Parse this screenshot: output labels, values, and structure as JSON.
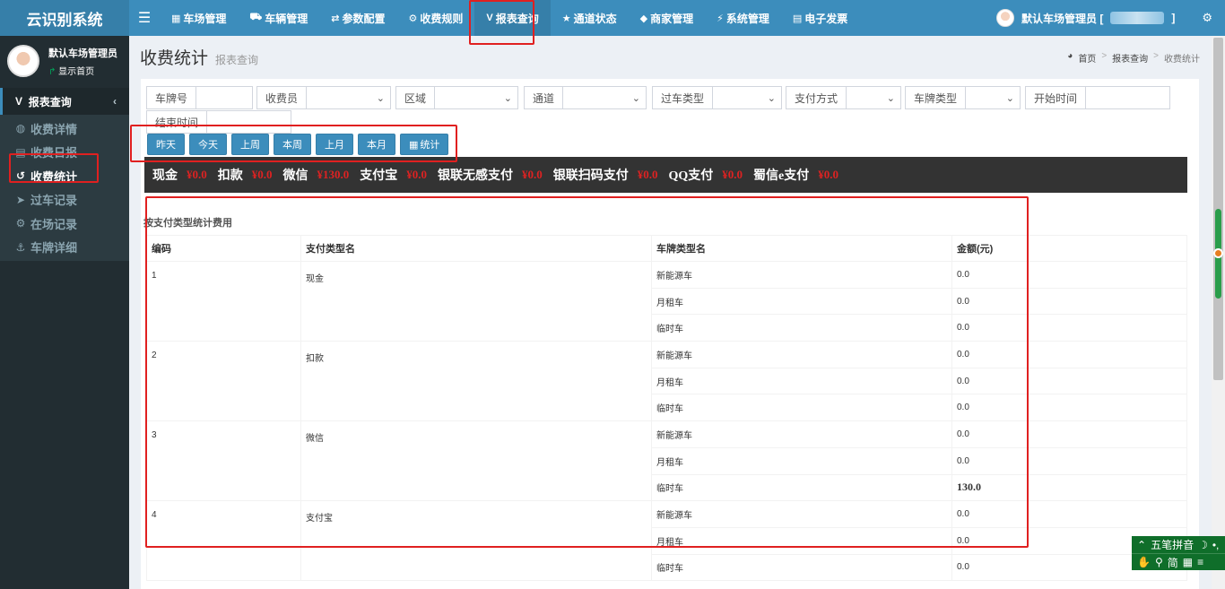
{
  "app": {
    "brand": "云识别系统"
  },
  "topnav": {
    "items": [
      {
        "icon": "▦",
        "label": "车场管理"
      },
      {
        "icon": "⛟",
        "label": "车辆管理"
      },
      {
        "icon": "⇄",
        "label": "参数配置"
      },
      {
        "icon": "⚙",
        "label": "收费规则"
      },
      {
        "icon": "V",
        "label": "报表查询"
      },
      {
        "icon": "★",
        "label": "通道状态"
      },
      {
        "icon": "◆",
        "label": "商家管理"
      },
      {
        "icon": "⚡",
        "label": "系统管理"
      },
      {
        "icon": "▤",
        "label": "电子发票"
      }
    ],
    "user_label": "默认车场管理员 [",
    "user_bracket_close": "]"
  },
  "sidebar": {
    "user_name": "默认车场管理员",
    "user_link": "显示首页",
    "section": {
      "icon": "V",
      "label": "报表查询"
    },
    "items": [
      {
        "icon": "◍",
        "label": "收费详情"
      },
      {
        "icon": "▤",
        "label": "收费日报"
      },
      {
        "icon": "↺",
        "label": "收费统计"
      },
      {
        "icon": "➤",
        "label": "过车记录"
      },
      {
        "icon": "⚙",
        "label": "在场记录"
      },
      {
        "icon": "⚓",
        "label": "车牌详细"
      }
    ]
  },
  "page": {
    "title": "收费统计",
    "subtitle": "报表查询",
    "breadcrumb": [
      "首页",
      "报表查询",
      "收费统计"
    ]
  },
  "filters": [
    {
      "label": "车牌号",
      "type": "text",
      "value": ""
    },
    {
      "label": "收费员",
      "type": "select",
      "value": ""
    },
    {
      "label": "区域",
      "type": "select",
      "value": ""
    },
    {
      "label": "通道",
      "type": "select",
      "value": ""
    },
    {
      "label": "过车类型",
      "type": "select",
      "value": ""
    },
    {
      "label": "支付方式",
      "type": "select",
      "value": ""
    },
    {
      "label": "车牌类型",
      "type": "select",
      "value": ""
    },
    {
      "label": "开始时间",
      "type": "text",
      "value": ""
    },
    {
      "label": "结束时间",
      "type": "text",
      "value": ""
    }
  ],
  "quick_buttons": [
    "昨天",
    "今天",
    "上周",
    "本周",
    "上月",
    "本月"
  ],
  "stats_button": {
    "icon": "▦",
    "label": "统计"
  },
  "summary": [
    {
      "label": "现金",
      "value": "¥0.0"
    },
    {
      "label": "扣款",
      "value": "¥0.0"
    },
    {
      "label": "微信",
      "value": "¥130.0"
    },
    {
      "label": "支付宝",
      "value": "¥0.0"
    },
    {
      "label": "银联无感支付",
      "value": "¥0.0"
    },
    {
      "label": "银联扫码支付",
      "value": "¥0.0"
    },
    {
      "label": "QQ支付",
      "value": "¥0.0"
    },
    {
      "label": "蜀信e支付",
      "value": "¥0.0"
    }
  ],
  "table": {
    "title": "按支付类型统计费用",
    "headers": [
      "编码",
      "支付类型名",
      "车牌类型名",
      "金额(元)"
    ],
    "groups": [
      {
        "code": "1",
        "pay_type": "现金",
        "rows": [
          {
            "plate_type": "新能源车",
            "amount": "0.0"
          },
          {
            "plate_type": "月租车",
            "amount": "0.0"
          },
          {
            "plate_type": "临时车",
            "amount": "0.0"
          }
        ]
      },
      {
        "code": "2",
        "pay_type": "扣款",
        "rows": [
          {
            "plate_type": "新能源车",
            "amount": "0.0"
          },
          {
            "plate_type": "月租车",
            "amount": "0.0"
          },
          {
            "plate_type": "临时车",
            "amount": "0.0"
          }
        ]
      },
      {
        "code": "3",
        "pay_type": "微信",
        "rows": [
          {
            "plate_type": "新能源车",
            "amount": "0.0"
          },
          {
            "plate_type": "月租车",
            "amount": "0.0"
          },
          {
            "plate_type": "临时车",
            "amount": "130.0"
          }
        ]
      },
      {
        "code": "4",
        "pay_type": "支付宝",
        "rows": [
          {
            "plate_type": "新能源车",
            "amount": "0.0"
          },
          {
            "plate_type": "月租车",
            "amount": "0.0"
          },
          {
            "plate_type": "临时车",
            "amount": "0.0"
          }
        ]
      }
    ]
  },
  "ime": {
    "row1": "五笔拼音",
    "row2": "简"
  },
  "colors": {
    "topbar": "#3c8dbc",
    "sidebar": "#222d32",
    "highlight_amount": "#dd2222",
    "annotation": "#e02020"
  }
}
